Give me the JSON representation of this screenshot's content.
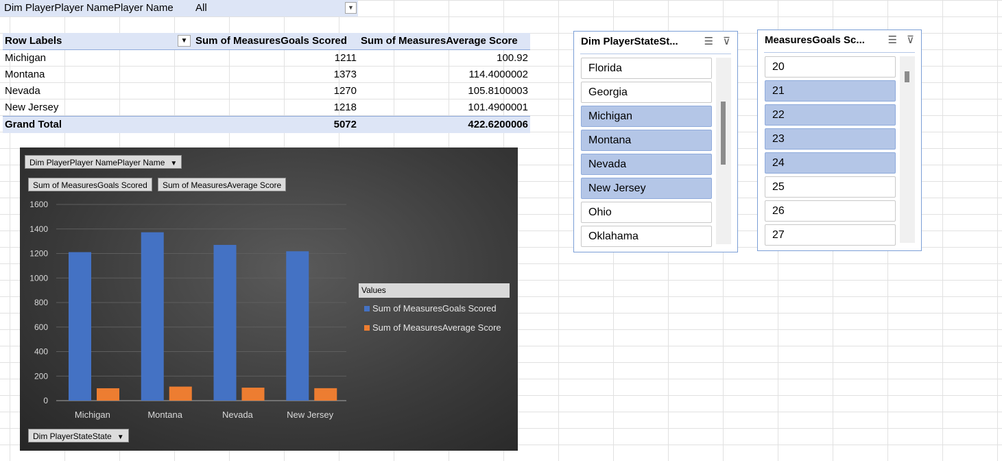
{
  "filter": {
    "label": "Dim PlayerPlayer NamePlayer Name",
    "value": "All"
  },
  "pivot": {
    "headers": [
      "Row Labels",
      "Sum of MeasuresGoals Scored",
      "Sum of MeasuresAverage Score"
    ],
    "rows": [
      [
        "Michigan",
        "1211",
        "100.92"
      ],
      [
        "Montana",
        "1373",
        "114.4000002"
      ],
      [
        "Nevada",
        "1270",
        "105.8100003"
      ],
      [
        "New Jersey",
        "1218",
        "101.4900001"
      ]
    ],
    "total": [
      "Grand Total",
      "5072",
      "422.6200006"
    ]
  },
  "chart": {
    "filter_chip": "Dim PlayerPlayer NamePlayer  Name",
    "value_chips": [
      "Sum of MeasuresGoals Scored",
      "Sum of MeasuresAverage Score"
    ],
    "axis_chip": "Dim PlayerStateState",
    "legend_title": "Values"
  },
  "chart_data": {
    "type": "bar",
    "categories": [
      "Michigan",
      "Montana",
      "Nevada",
      "New Jersey"
    ],
    "series": [
      {
        "name": "Sum of MeasuresGoals Scored",
        "values": [
          1211,
          1373,
          1270,
          1218
        ],
        "color": "#4472c4"
      },
      {
        "name": "Sum of MeasuresAverage Score",
        "values": [
          100.92,
          114.4000002,
          105.8100003,
          101.4900001
        ],
        "color": "#ed7d31"
      }
    ],
    "ylim": [
      0,
      1600
    ],
    "yticks": [
      "0",
      "200",
      "400",
      "600",
      "800",
      "1000",
      "1200",
      "1400",
      "1600"
    ],
    "grid": true,
    "legend": "right"
  },
  "slicer_state": {
    "title": "Dim PlayerStateSt...",
    "items": [
      {
        "label": "Florida",
        "selected": false
      },
      {
        "label": "Georgia",
        "selected": false
      },
      {
        "label": "Michigan",
        "selected": true
      },
      {
        "label": "Montana",
        "selected": true
      },
      {
        "label": "Nevada",
        "selected": true
      },
      {
        "label": "New Jersey",
        "selected": true
      },
      {
        "label": "Ohio",
        "selected": false
      },
      {
        "label": "Oklahama",
        "selected": false
      }
    ]
  },
  "slicer_goals": {
    "title": "MeasuresGoals Sc...",
    "items": [
      {
        "label": "20",
        "selected": false
      },
      {
        "label": "21",
        "selected": true
      },
      {
        "label": "22",
        "selected": true
      },
      {
        "label": "23",
        "selected": true
      },
      {
        "label": "24",
        "selected": true
      },
      {
        "label": "25",
        "selected": false
      },
      {
        "label": "26",
        "selected": false
      },
      {
        "label": "27",
        "selected": false
      }
    ]
  },
  "icons": {
    "multiselect": "multi-select-icon",
    "clear_filter": "clear-filter-icon",
    "dropdown": "dropdown-arrow-icon"
  },
  "colors": {
    "selected": "#b4c6e7",
    "header": "#dde5f6",
    "accent": "#4472c4",
    "orange": "#ed7d31"
  }
}
